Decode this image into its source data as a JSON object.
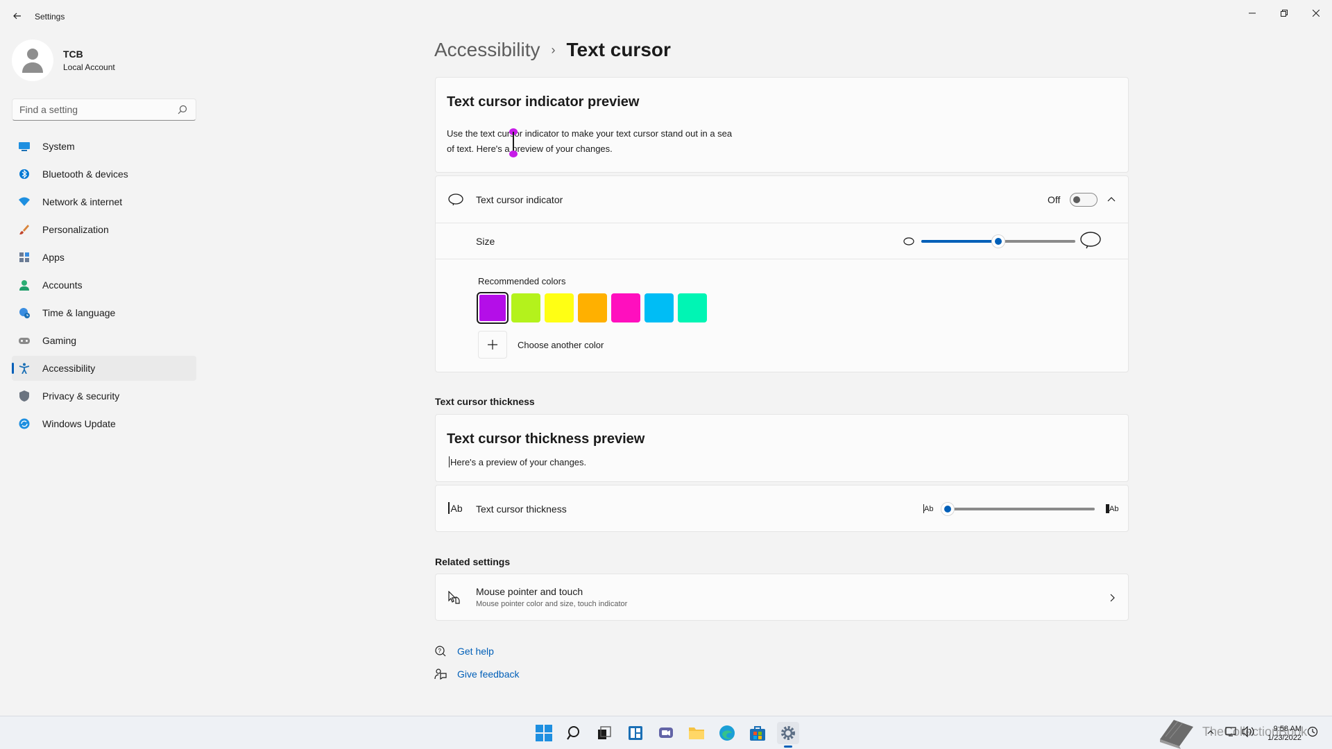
{
  "window": {
    "title": "Settings"
  },
  "profile": {
    "name": "TCB",
    "account_type": "Local Account"
  },
  "search": {
    "placeholder": "Find a setting"
  },
  "sidebar": {
    "items": [
      {
        "label": "System",
        "icon": "monitor-icon",
        "color": "#0078d4"
      },
      {
        "label": "Bluetooth & devices",
        "icon": "bluetooth-icon",
        "color": "#0078d4"
      },
      {
        "label": "Network & internet",
        "icon": "wifi-icon",
        "color": "#0078d4"
      },
      {
        "label": "Personalization",
        "icon": "brush-icon",
        "color": "#d35f3a"
      },
      {
        "label": "Apps",
        "icon": "apps-icon",
        "color": "#5a6b85"
      },
      {
        "label": "Accounts",
        "icon": "person-icon",
        "color": "#2cae74"
      },
      {
        "label": "Time & language",
        "icon": "globe-clock-icon",
        "color": "#0078d4"
      },
      {
        "label": "Gaming",
        "icon": "gamepad-icon",
        "color": "#7a7a7a"
      },
      {
        "label": "Accessibility",
        "icon": "accessibility-icon",
        "color": "#0078d4"
      },
      {
        "label": "Privacy & security",
        "icon": "shield-icon",
        "color": "#6b7480"
      },
      {
        "label": "Windows Update",
        "icon": "update-icon",
        "color": "#0078d4"
      }
    ],
    "active_index": 8
  },
  "breadcrumb": {
    "parent": "Accessibility",
    "separator": "›",
    "current": "Text cursor"
  },
  "indicator_preview": {
    "title": "Text cursor indicator preview",
    "line1": "Use the text cursor indicator to make your text cursor stand out in a sea",
    "line2": "of text. Here's a preview of your changes."
  },
  "indicator_setting": {
    "label": "Text cursor indicator",
    "state_text": "Off",
    "enabled": false,
    "size_label": "Size",
    "size_value": 0.5,
    "colors_label": "Recommended colors",
    "colors": [
      "#b40ee8",
      "#b4f21c",
      "#ffff14",
      "#ffb000",
      "#ff0fbe",
      "#00bdf5",
      "#00f5b4"
    ],
    "selected_color": 0,
    "choose_color_label": "Choose another color"
  },
  "thickness": {
    "section_label": "Text cursor thickness",
    "preview_title": "Text cursor thickness preview",
    "preview_text": "Here's a preview of your changes.",
    "setting_label": "Text cursor thickness",
    "icon_text": "Ab",
    "value": 0
  },
  "related": {
    "section_label": "Related settings",
    "item_title": "Mouse pointer and touch",
    "item_subtitle": "Mouse pointer color and size, touch indicator"
  },
  "help": {
    "get_help": "Get help",
    "give_feedback": "Give feedback"
  },
  "taskbar": {
    "time": "9:58 AM",
    "date": "1/23/2022"
  },
  "watermark": "TheCollectionBook",
  "accent": "#005fb8"
}
